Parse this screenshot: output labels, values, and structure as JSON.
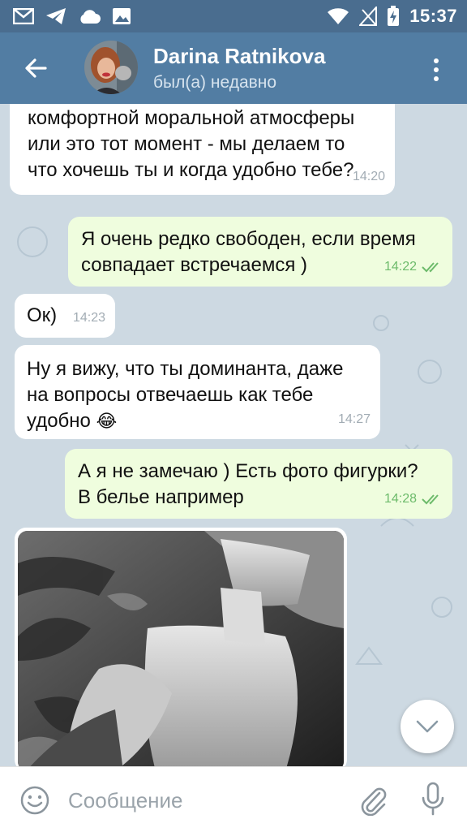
{
  "statusbar": {
    "time": "15:37"
  },
  "header": {
    "contact_name": "Darina Ratnikova",
    "contact_status": "был(а) недавно"
  },
  "messages": [
    {
      "direction": "in",
      "text": "комфортной моральной атмосферы\nили это тот момент - мы делаем то\nчто хочешь ты и когда удобно тебе?",
      "time": "14:20"
    },
    {
      "direction": "out",
      "text": "Я очень редко свободен, если время\nсовпадает встречаемся )",
      "time": "14:22"
    },
    {
      "direction": "in",
      "text": "Ок)",
      "time": "14:23"
    },
    {
      "direction": "in",
      "text": "Ну я вижу, что ты доминанта, даже\nна вопросы отвечаешь как тебе\nудобно",
      "time": "14:27",
      "emoji": "😂"
    },
    {
      "direction": "out",
      "text": "А я не замечаю ) Есть фото фигурки?\nВ белье например",
      "time": "14:28"
    }
  ],
  "composer": {
    "placeholder": "Сообщение"
  },
  "colors": {
    "header": "#527da3",
    "statusbar": "#4a6d8f",
    "outgoing_bubble": "#effdde",
    "incoming_bubble": "#ffffff",
    "read_checks": "#6dbb6b"
  }
}
